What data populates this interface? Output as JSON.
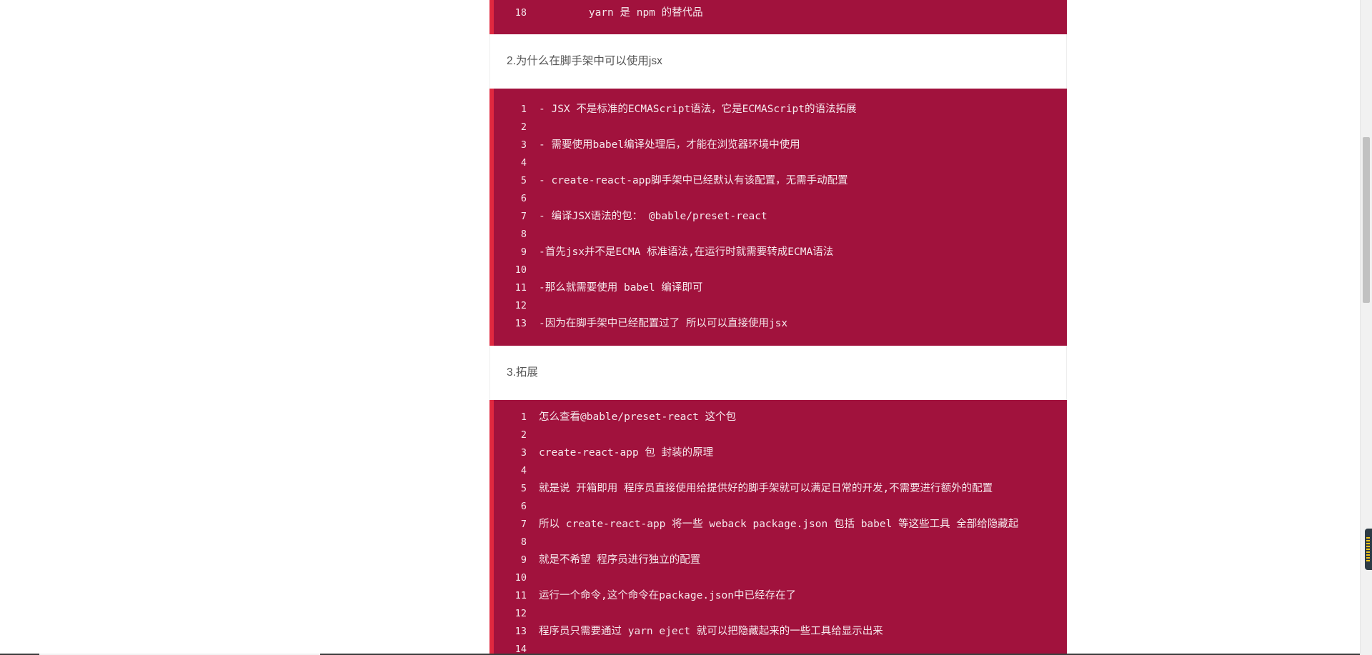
{
  "top_block": {
    "lines": [
      {
        "num": "18",
        "code": "        yarn 是 npm 的替代品"
      }
    ]
  },
  "section_2": {
    "heading": "2.为什么在脚手架中可以使用jsx",
    "lines": [
      {
        "num": "1",
        "code": "- JSX 不是标准的ECMAScript语法，它是ECMAScript的语法拓展"
      },
      {
        "num": "2",
        "code": ""
      },
      {
        "num": "3",
        "code": "- 需要使用babel编译处理后，才能在浏览器环境中使用"
      },
      {
        "num": "4",
        "code": ""
      },
      {
        "num": "5",
        "code": "- create-react-app脚手架中已经默认有该配置，无需手动配置"
      },
      {
        "num": "6",
        "code": ""
      },
      {
        "num": "7",
        "code": "- 编译JSX语法的包： @bable/preset-react"
      },
      {
        "num": "8",
        "code": ""
      },
      {
        "num": "9",
        "code": "-首先jsx并不是ECMA 标准语法,在运行时就需要转成ECMA语法"
      },
      {
        "num": "10",
        "code": ""
      },
      {
        "num": "11",
        "code": "-那么就需要使用 babel 编译即可"
      },
      {
        "num": "12",
        "code": ""
      },
      {
        "num": "13",
        "code": "-因为在脚手架中已经配置过了 所以可以直接使用jsx"
      }
    ]
  },
  "section_3": {
    "heading": "3.拓展",
    "lines": [
      {
        "num": "1",
        "code": "怎么查看@bable/preset-react 这个包"
      },
      {
        "num": "2",
        "code": ""
      },
      {
        "num": "3",
        "code": "create-react-app 包 封装的原理"
      },
      {
        "num": "4",
        "code": ""
      },
      {
        "num": "5",
        "code": "就是说 开箱即用 程序员直接使用给提供好的脚手架就可以满足日常的开发,不需要进行额外的配置"
      },
      {
        "num": "6",
        "code": ""
      },
      {
        "num": "7",
        "code": "所以 create-react-app 将一些 weback package.json 包括 babel 等这些工具 全部给隐藏起"
      },
      {
        "num": "8",
        "code": ""
      },
      {
        "num": "9",
        "code": "就是不希望 程序员进行独立的配置"
      },
      {
        "num": "10",
        "code": ""
      },
      {
        "num": "11",
        "code": "运行一个命令,这个命令在package.json中已经存在了"
      },
      {
        "num": "12",
        "code": ""
      },
      {
        "num": "13",
        "code": "程序员只需要通过 yarn eject 就可以把隐藏起来的一些工具给显示出来"
      },
      {
        "num": "14",
        "code": ""
      }
    ]
  }
}
